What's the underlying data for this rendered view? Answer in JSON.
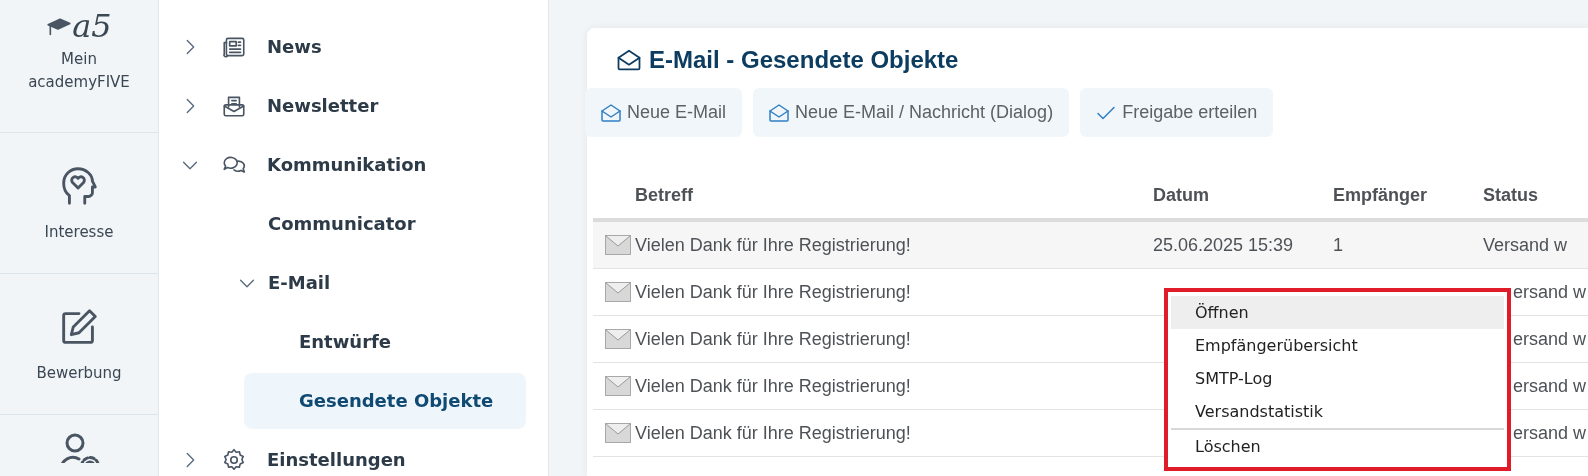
{
  "rail": {
    "logo_text": "a5",
    "items": [
      {
        "kind": "logo",
        "label": "Mein academyFIVE"
      },
      {
        "kind": "link",
        "label": "Interesse"
      },
      {
        "kind": "link",
        "label": "Bewerbung"
      },
      {
        "kind": "link"
      }
    ]
  },
  "nav": [
    {
      "label": "News",
      "expanded": false
    },
    {
      "label": "Newsletter",
      "expanded": false
    },
    {
      "label": "Kommunikation",
      "expanded": true,
      "children": [
        {
          "label": "Communicator",
          "selected": false
        },
        {
          "label": "E-Mail",
          "expanded": true,
          "children": [
            {
              "label": "Entwürfe",
              "selected": false
            },
            {
              "label": "Gesendete Objekte",
              "selected": true
            }
          ]
        }
      ]
    },
    {
      "label": "Einstellungen",
      "expanded": false
    }
  ],
  "page": {
    "title": "E-Mail - Gesendete Objekte",
    "buttons": [
      {
        "label": "Neue E-Mail"
      },
      {
        "label": "Neue E-Mail / Nachricht (Dialog)"
      },
      {
        "label": "Freigabe erteilen"
      }
    ],
    "table": {
      "columns": [
        "Betreff",
        "Datum",
        "Empfänger",
        "Status"
      ],
      "rows": [
        {
          "subject": "Vielen Dank für Ihre Registrierung!",
          "date": "25.06.2025 15:39",
          "recipients": "1",
          "status": "Versand w"
        },
        {
          "subject": "Vielen Dank für Ihre Registrierung!",
          "status": "ersand w"
        },
        {
          "subject": "Vielen Dank für Ihre Registrierung!",
          "status": "ersand w"
        },
        {
          "subject": "Vielen Dank für Ihre Registrierung!",
          "status": "ersand w"
        },
        {
          "subject": "Vielen Dank für Ihre Registrierung!",
          "status": "ersand w"
        }
      ]
    },
    "context_menu": [
      {
        "label": "Öffnen",
        "selected": true
      },
      {
        "label": "Empfängerübersicht",
        "selected": false
      },
      {
        "label": "SMTP-Log",
        "selected": false
      },
      {
        "label": "Versandstatistik",
        "selected": false
      },
      {
        "label": "Löschen",
        "selected": false,
        "separator_before": true
      }
    ]
  }
}
